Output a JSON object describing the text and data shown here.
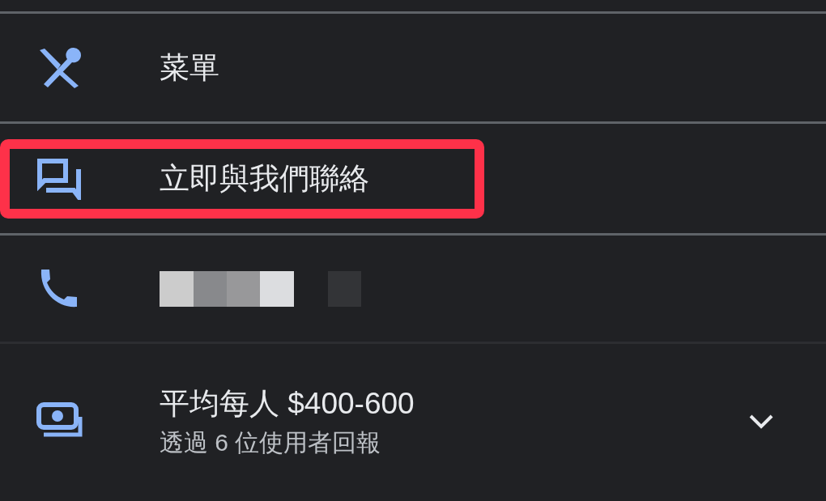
{
  "items": [
    {
      "kind": "menu",
      "label": "菜單",
      "highlighted": false
    },
    {
      "kind": "contact",
      "label": "立即與我們聯絡",
      "highlighted": true
    },
    {
      "kind": "phone",
      "redacted": true,
      "highlighted": false
    },
    {
      "kind": "price",
      "label": "平均每人 $400-600",
      "sublabel": "透過 6 位使用者回報",
      "expanded": false,
      "highlighted": false
    }
  ]
}
